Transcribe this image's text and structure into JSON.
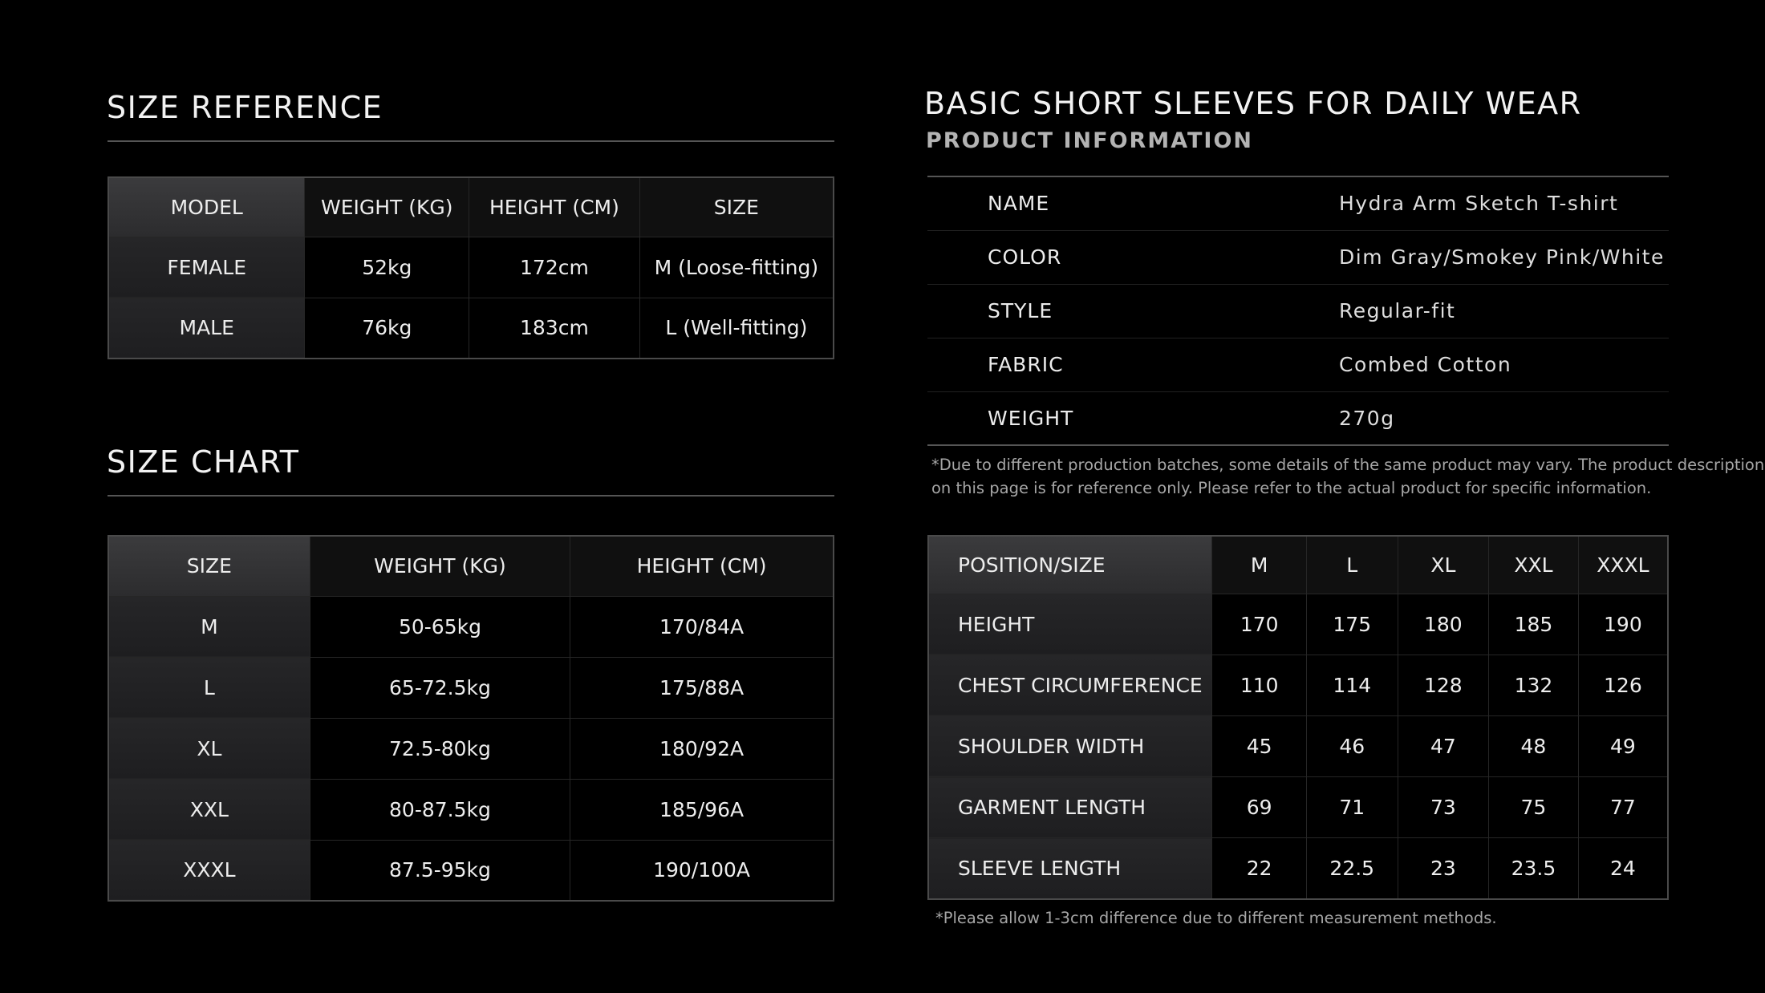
{
  "size_reference": {
    "title": "SIZE REFERENCE",
    "headers": [
      "MODEL",
      "WEIGHT (KG)",
      "HEIGHT (CM)",
      "SIZE"
    ],
    "rows": [
      [
        "FEMALE",
        "52kg",
        "172cm",
        "M (Loose-fitting)"
      ],
      [
        "MALE",
        "76kg",
        "183cm",
        "L (Well-fitting)"
      ]
    ]
  },
  "size_chart": {
    "title": "SIZE CHART",
    "headers": [
      "SIZE",
      "WEIGHT (KG)",
      "HEIGHT (CM)"
    ],
    "rows": [
      [
        "M",
        "50-65kg",
        "170/84A"
      ],
      [
        "L",
        "65-72.5kg",
        "175/88A"
      ],
      [
        "XL",
        "72.5-80kg",
        "180/92A"
      ],
      [
        "XXL",
        "80-87.5kg",
        "185/96A"
      ],
      [
        "XXXL",
        "87.5-95kg",
        "190/100A"
      ]
    ]
  },
  "product": {
    "title": "BASIC SHORT SLEEVES FOR DAILY WEAR",
    "subtitle": "PRODUCT INFORMATION",
    "rows": [
      [
        "NAME",
        "Hydra Arm Sketch T-shirt"
      ],
      [
        "COLOR",
        "Dim Gray/Smokey Pink/White"
      ],
      [
        "STYLE",
        "Regular-fit"
      ],
      [
        "FABRIC",
        "Combed Cotton"
      ],
      [
        "WEIGHT",
        "270g"
      ]
    ],
    "note_line1": "*Due to different production batches, some details of the same product may vary. The product description",
    "note_line2": "on this page is for reference only. Please refer to the actual product for specific information."
  },
  "measurements": {
    "headers": [
      "POSITION/SIZE",
      "M",
      "L",
      "XL",
      "XXL",
      "XXXL"
    ],
    "rows": [
      [
        "HEIGHT",
        "170",
        "175",
        "180",
        "185",
        "190"
      ],
      [
        "CHEST CIRCUMFERENCE",
        "110",
        "114",
        "128",
        "132",
        "126"
      ],
      [
        "SHOULDER WIDTH",
        "45",
        "46",
        "47",
        "48",
        "49"
      ],
      [
        "GARMENT LENGTH",
        "69",
        "71",
        "73",
        "75",
        "77"
      ],
      [
        "SLEEVE LENGTH",
        "22",
        "22.5",
        "23",
        "23.5",
        "24"
      ]
    ],
    "note": "*Please allow 1-3cm difference due to different measurement methods."
  }
}
